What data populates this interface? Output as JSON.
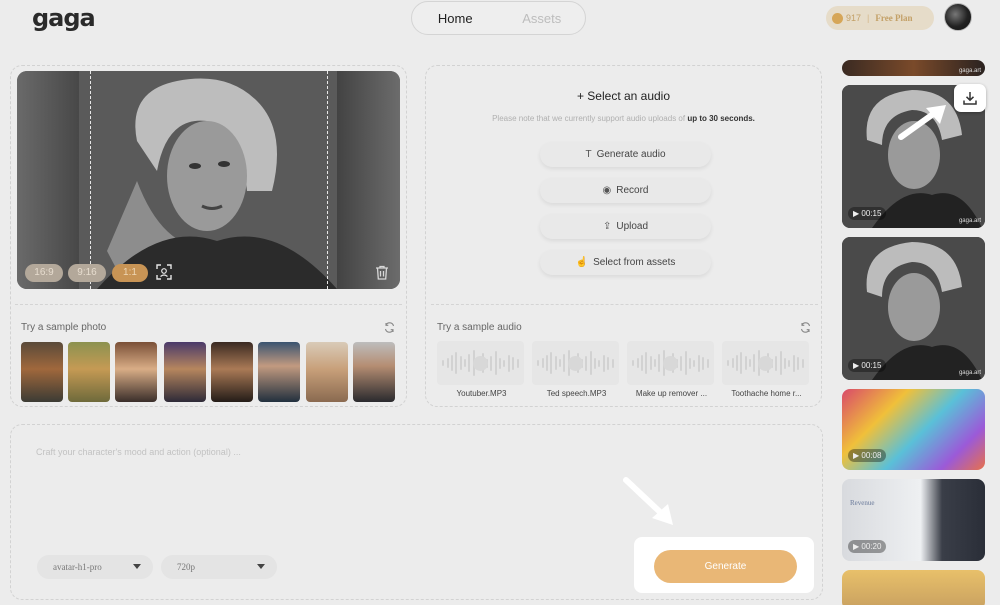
{
  "header": {
    "logo": "gaga",
    "tabs": [
      {
        "label": "Home",
        "active": true
      },
      {
        "label": "Assets",
        "active": false
      }
    ],
    "credits": "917",
    "plan": "Free Plan"
  },
  "photo": {
    "ratios": [
      "16:9",
      "9:16",
      "1:1"
    ],
    "selected_ratio": "1:1",
    "sample_label": "Try a sample photo",
    "sample_count": 8
  },
  "audio": {
    "title": "+ Select an audio",
    "note_prefix": "Please note that we currently support audio uploads of",
    "note_bold": "up to 30 seconds.",
    "buttons": [
      {
        "icon": "T",
        "label": "Generate audio"
      },
      {
        "icon": "◉",
        "label": "Record"
      },
      {
        "icon": "⇪",
        "label": "Upload"
      },
      {
        "icon": "☝",
        "label": "Select from assets"
      }
    ],
    "sample_label": "Try a sample audio",
    "samples": [
      "Youtuber.MP3",
      "Ted speech.MP3",
      "Make up remover ...",
      "Toothache home r..."
    ]
  },
  "prompt": {
    "placeholder": "Craft your character's mood and action (optional) ...",
    "model": "avatar-h1-pro",
    "resolution": "720p",
    "generate_label": "Generate"
  },
  "rail": {
    "watermark": "gaga.art",
    "durations": [
      "00:15",
      "00:15",
      "00:08",
      "00:20"
    ],
    "whiteboard_text": "Revenue"
  },
  "colors": {
    "accent": "#e9b776",
    "ratio_selected": "#c89455",
    "background": "#ececec"
  }
}
